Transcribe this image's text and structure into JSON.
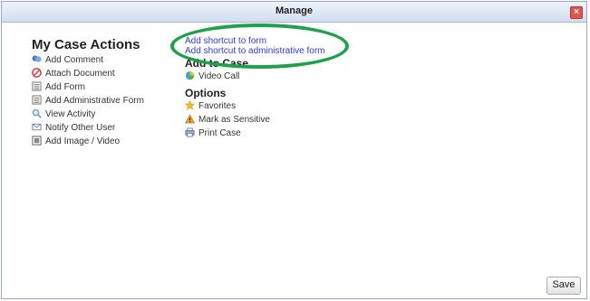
{
  "window": {
    "title": "Manage",
    "close_symbol": "×"
  },
  "my_case_actions": {
    "heading": "My Case Actions",
    "items": [
      {
        "label": "Add Comment",
        "icon": "comment-icon"
      },
      {
        "label": "Attach Document",
        "icon": "attach-icon"
      },
      {
        "label": "Add Form",
        "icon": "form-icon"
      },
      {
        "label": "Add Administrative Form",
        "icon": "admin-form-icon"
      },
      {
        "label": "View Activity",
        "icon": "magnifier-icon"
      },
      {
        "label": "Notify Other User",
        "icon": "envelope-icon"
      },
      {
        "label": "Add Image / Video",
        "icon": "image-icon"
      }
    ]
  },
  "shortcuts": {
    "add_to_form": "Add shortcut to form",
    "add_to_admin_form": "Add shortcut to administrative form"
  },
  "add_to_case": {
    "heading": "Add to Case",
    "items": [
      {
        "label": "Video Call",
        "icon": "video-call-icon"
      }
    ]
  },
  "options": {
    "heading": "Options",
    "items": [
      {
        "label": "Favorites",
        "icon": "star-icon"
      },
      {
        "label": "Mark as Sensitive",
        "icon": "warning-icon"
      },
      {
        "label": "Print Case",
        "icon": "printer-icon"
      }
    ]
  },
  "footer": {
    "save_label": "Save"
  },
  "colors": {
    "link": "#2f3ad0",
    "highlight": "#1fa04a",
    "close": "#e0584c"
  }
}
